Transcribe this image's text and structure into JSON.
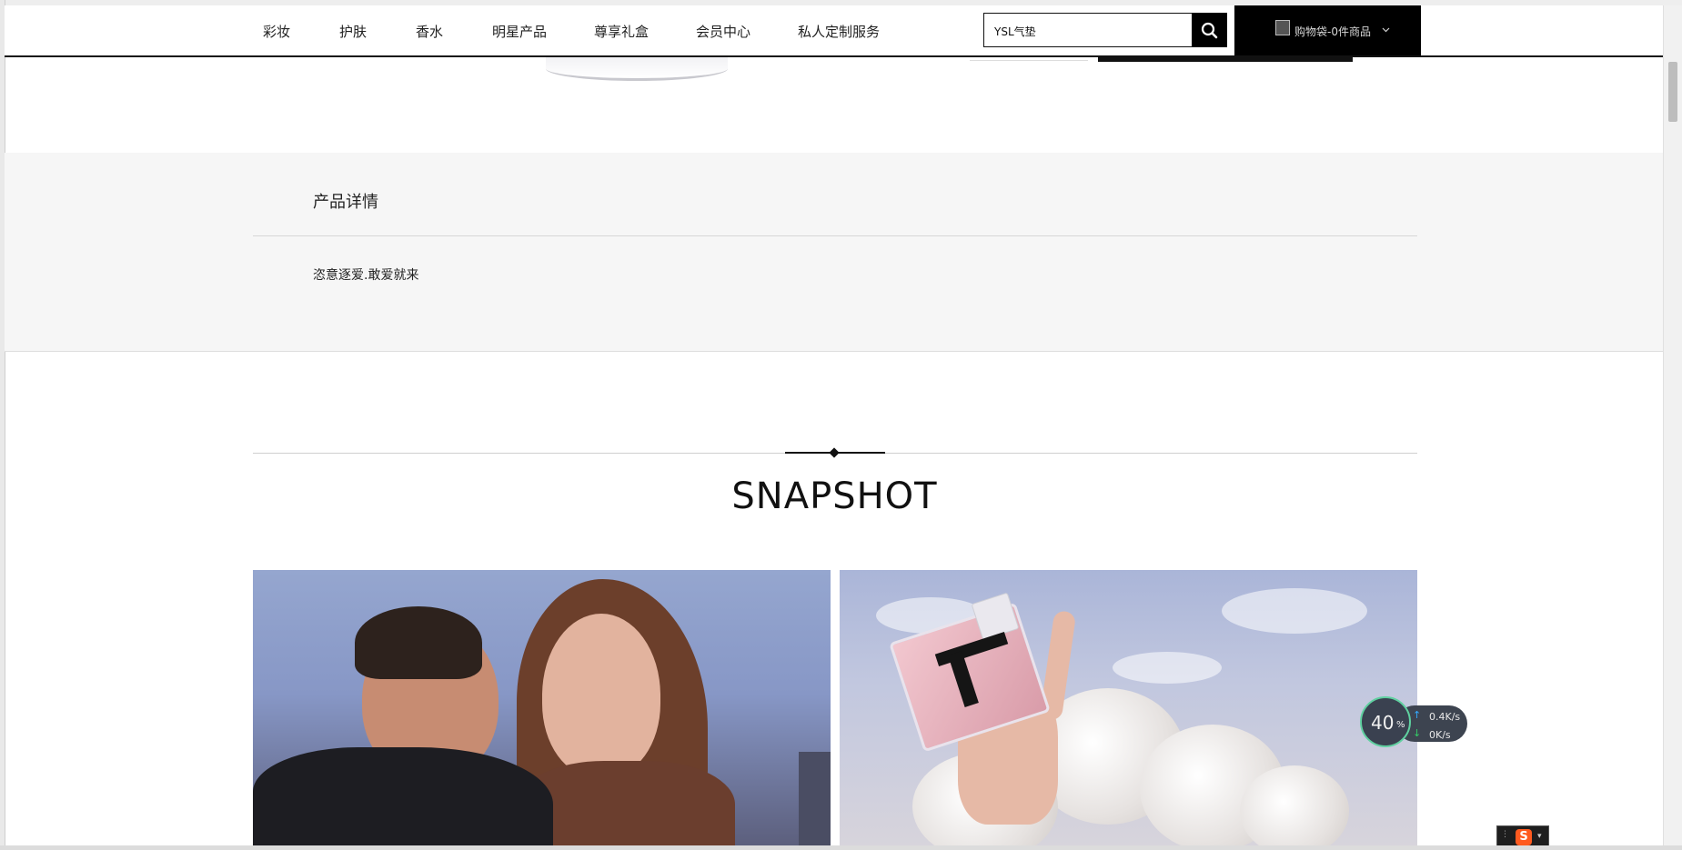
{
  "nav": {
    "items": [
      "彩妆",
      "护肤",
      "香水",
      "明星产品",
      "尊享礼盒",
      "会员中心",
      "私人定制服务"
    ],
    "search_value": "YSL气垫",
    "cart_label": "购物袋-0件商品"
  },
  "detail": {
    "title": "产品详情",
    "description": "恣意逐爱.敢爱就来"
  },
  "snapshot": {
    "title": "SNAPSHOT"
  },
  "speed_widget": {
    "percent": "40",
    "percent_unit": "%",
    "upload": "0.4K/s",
    "download": "0K/s"
  },
  "ime": {
    "label": "S"
  },
  "colors": {
    "accent": "#000000",
    "detail_bg": "#f6f6f6"
  }
}
